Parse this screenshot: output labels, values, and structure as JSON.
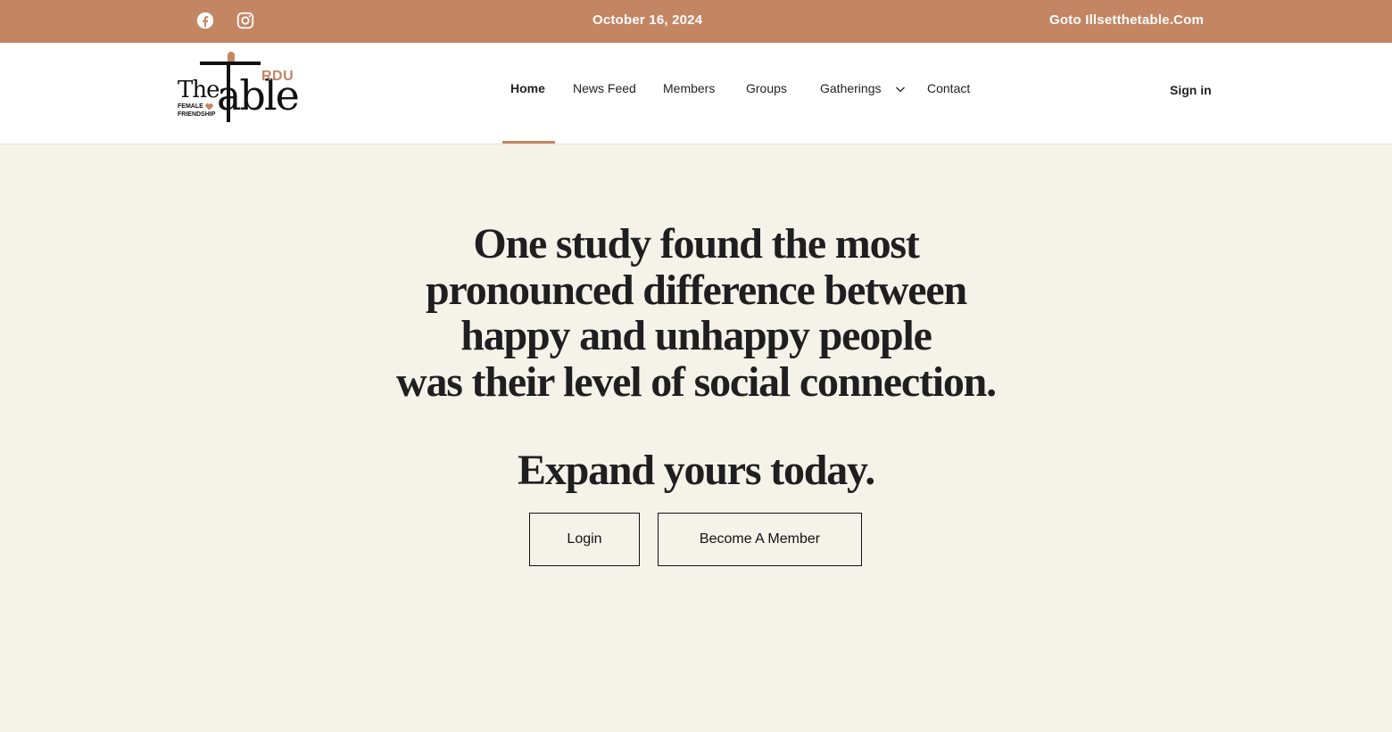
{
  "topbar": {
    "date": "October 16, 2024",
    "goto_link": "Goto Illsetthetable.Com",
    "social": [
      "facebook-icon",
      "instagram-icon"
    ]
  },
  "logo": {
    "word_the": "The",
    "word_table": "able",
    "badge": "RDU",
    "tagline": "FEMALE\nFRIENDSHIP",
    "accent_color": "#c48563"
  },
  "nav": {
    "items": [
      {
        "label": "Home",
        "active": true
      },
      {
        "label": "News Feed"
      },
      {
        "label": "Members"
      },
      {
        "label": "Groups"
      },
      {
        "label": "Gatherings",
        "has_dropdown": true
      },
      {
        "label": "Contact"
      }
    ],
    "signin": "Sign in"
  },
  "hero": {
    "headline_lines": [
      "One study found the most",
      "pronounced difference between",
      "happy and unhappy people",
      "was their level of social connection."
    ],
    "subhead": "Expand yours today.",
    "buttons": {
      "login": "Login",
      "member": "Become A Member"
    }
  },
  "colors": {
    "brand": "#c48563",
    "background": "#f5f2ea",
    "text": "#222222"
  }
}
